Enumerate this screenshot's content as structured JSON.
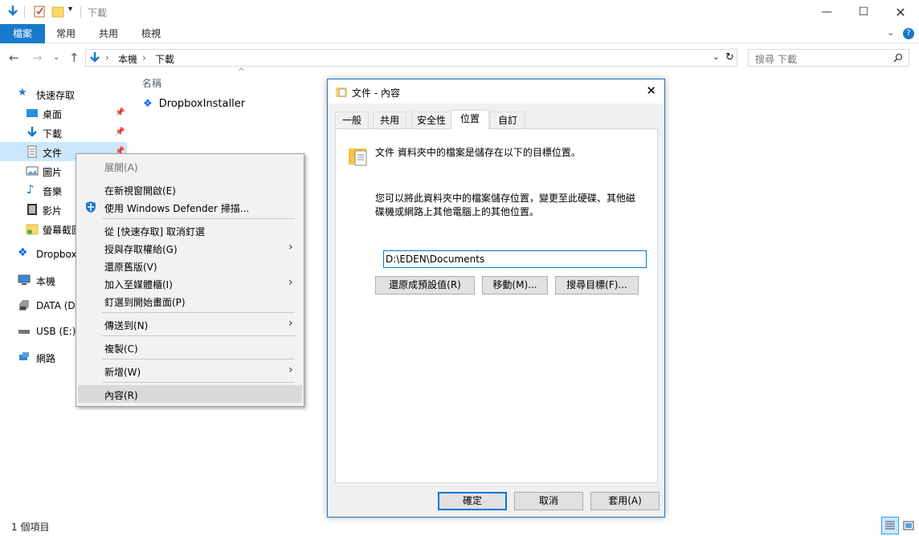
{
  "window": {
    "title": "下載",
    "breadcrumb": [
      "本機",
      "下載"
    ],
    "search_placeholder": "搜尋 下載"
  },
  "ribbon": {
    "tabs": [
      "檔案",
      "常用",
      "共用",
      "檢視"
    ]
  },
  "nav": {
    "items": [
      {
        "label": "快速存取"
      },
      {
        "label": "桌面"
      },
      {
        "label": "下載"
      },
      {
        "label": "文件"
      },
      {
        "label": "圖片"
      },
      {
        "label": "音樂"
      },
      {
        "label": "影片"
      },
      {
        "label": "螢幕截圖"
      },
      {
        "label": "Dropbox"
      },
      {
        "label": "本機"
      },
      {
        "label": "DATA (D:)"
      },
      {
        "label": "USB (E:)"
      },
      {
        "label": "網路"
      }
    ]
  },
  "content": {
    "column_name": "名稱",
    "files": [
      "DropboxInstaller"
    ]
  },
  "status": {
    "item_count": "1 個項目"
  },
  "context_menu": {
    "items": [
      {
        "label": "展開(A)"
      },
      {
        "label": "在新視窗開啟(E)"
      },
      {
        "label": "使用 Windows Defender 掃描..."
      },
      {
        "label": "從 [快速存取] 取消釘選"
      },
      {
        "label": "授與存取權給(G)"
      },
      {
        "label": "還原舊版(V)"
      },
      {
        "label": "加入至媒體櫃(I)"
      },
      {
        "label": "釘選到開始畫面(P)"
      },
      {
        "label": "傳送到(N)"
      },
      {
        "label": "複製(C)"
      },
      {
        "label": "新增(W)"
      },
      {
        "label": "內容(R)"
      }
    ]
  },
  "dialog": {
    "title": "文件 - 內容",
    "tabs": [
      "一般",
      "共用",
      "安全性",
      "位置",
      "自訂"
    ],
    "active_tab": "位置",
    "info_text": "文件 資料夾中的檔案是儲存在以下的目標位置。",
    "desc_line1": "您可以將此資料夾中的檔案儲存位置，變更至此硬碟、其他磁",
    "desc_line2": "碟機或網路上其他電腦上的其他位置。",
    "path_value": "D:\\EDEN\\Documents",
    "restore_button": "還原成預設值(R)",
    "move_button": "移動(M)...",
    "find_button": "搜尋目標(F)...",
    "ok_button": "確定",
    "cancel_button": "取消",
    "apply_button": "套用(A)"
  },
  "colors": {
    "accent": "#1979ca",
    "selection": "#cce8ff"
  }
}
